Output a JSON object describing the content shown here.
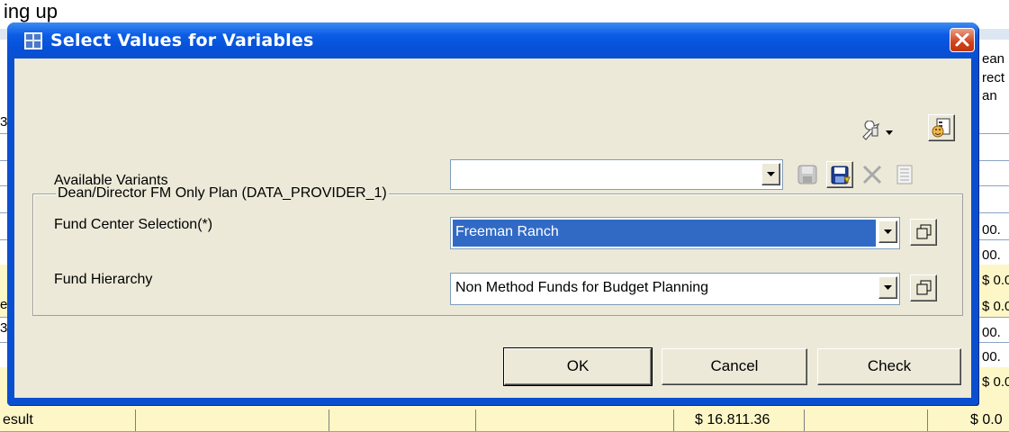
{
  "background": {
    "top_text": "ing up",
    "right_column": [
      "ean",
      "rect",
      "an",
      "00.",
      "00.",
      "$ 0.0",
      "$ 0.0",
      "00.",
      "00.",
      "$ 0.0"
    ],
    "left_fragments": [
      "3",
      "e",
      "3"
    ],
    "result_label": "esult",
    "result_value": "$ 16.811.36",
    "result_last": "$ 0.0"
  },
  "dialog": {
    "title": "Select Values for Variables",
    "available_variants_label": "Available Variants",
    "available_variants_value": "",
    "group_title": "Dean/Director FM Only Plan (DATA_PROVIDER_1)",
    "fund_center_label": "Fund Center Selection(*)",
    "fund_center_value": "Freeman Ranch",
    "fund_hierarchy_label": "Fund Hierarchy",
    "fund_hierarchy_value": "Non Method Funds for Budget Planning",
    "ok_label": "OK",
    "cancel_label": "Cancel",
    "check_label": "Check"
  },
  "colors": {
    "titlebar": "#0a4fcf",
    "client_bg": "#ece9d8",
    "selection": "#316ac5",
    "close": "#d0421c"
  }
}
